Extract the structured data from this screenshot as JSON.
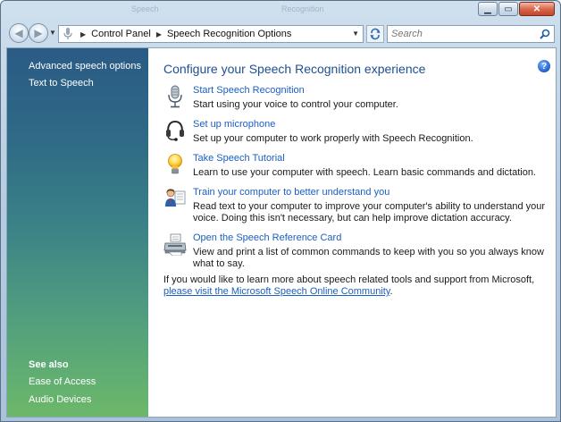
{
  "window": {
    "ghost_titles": [
      "Speech",
      "Recognition"
    ],
    "buttons": {
      "minimize": "▁",
      "maximize": "▭",
      "close": "✕"
    }
  },
  "navbar": {
    "breadcrumb": [
      "Control Panel",
      "Speech Recognition Options"
    ],
    "search_placeholder": "Search"
  },
  "sidebar": {
    "links": [
      {
        "label": "Advanced speech options"
      },
      {
        "label": "Text to Speech"
      }
    ],
    "see_also_heading": "See also",
    "see_also": [
      {
        "label": "Ease of Access"
      },
      {
        "label": "Audio Devices"
      }
    ]
  },
  "main": {
    "title": "Configure your Speech Recognition experience",
    "help_glyph": "?",
    "tasks": [
      {
        "icon": "microphone-icon",
        "link": "Start Speech Recognition",
        "description": "Start using your voice to control your computer."
      },
      {
        "icon": "headset-icon",
        "link": "Set up microphone",
        "description": "Set up your computer to work properly with Speech Recognition."
      },
      {
        "icon": "lightbulb-icon",
        "link": "Take Speech Tutorial",
        "description": "Learn to use your computer with speech.  Learn basic commands and dictation."
      },
      {
        "icon": "user-train-icon",
        "link": "Train your computer to better understand you",
        "description": "Read text to your computer to improve your computer's ability to understand your voice.  Doing this isn't necessary, but can help improve dictation accuracy."
      },
      {
        "icon": "printer-icon",
        "link": "Open the Speech Reference Card",
        "description": "View and print a list of common commands to keep with you so you always know what to say."
      }
    ],
    "footer": {
      "text": "If you would like to learn more about speech related tools and support from Microsoft, ",
      "link": "please visit the Microsoft Speech Online Community",
      "end": "."
    }
  },
  "colors": {
    "link": "#1b5fc1",
    "title": "#1d4f91",
    "sidebar_top": "#2a5b85",
    "sidebar_bottom": "#6cb86a"
  }
}
